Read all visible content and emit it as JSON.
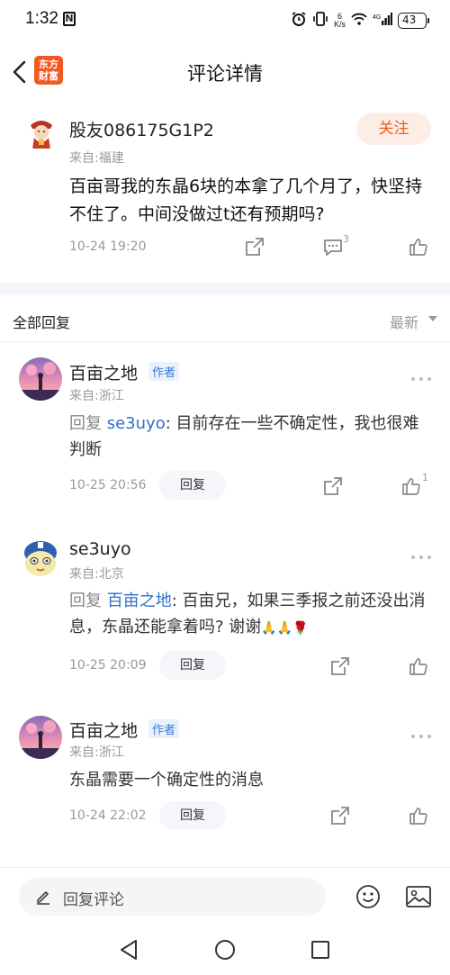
{
  "status_bar": {
    "time": "1:32",
    "n_badge": "N",
    "speed_top": "6",
    "speed_unit": "K/s",
    "battery": "43"
  },
  "header": {
    "title": "评论详情",
    "logo_line1": "东方",
    "logo_line2": "财富"
  },
  "post": {
    "author": "股友086175G1P2",
    "location": "来自:福建",
    "follow_label": "关注",
    "text": "百亩哥我的东晶6块的本拿了几个月了，快坚持不住了。中间没做过t还有预期吗?",
    "time": "10-24 19:20",
    "comment_count": "3"
  },
  "replies_section": {
    "title": "全部回复",
    "sort_label": "最新"
  },
  "replies": [
    {
      "name": "百亩之地",
      "tag": "作者",
      "location": "来自:浙江",
      "reply_word": "回复",
      "mention": "se3uyo",
      "text": ": 目前存在一些不确定性，我也很难判断",
      "time": "10-25 20:56",
      "reply_label": "回复",
      "like_count": "1"
    },
    {
      "name": "se3uyo",
      "location": "来自:北京",
      "reply_word": "回复",
      "mention": "百亩之地",
      "text": ": 百亩兄，如果三季报之前还没出消息，东晶还能拿着吗? 谢谢",
      "emojis": "🙏🙏🌹",
      "time": "10-25 20:09",
      "reply_label": "回复"
    },
    {
      "name": "百亩之地",
      "tag": "作者",
      "location": "来自:浙江",
      "text": "东晶需要一个确定性的消息",
      "time": "10-24 22:02",
      "reply_label": "回复"
    }
  ],
  "bottom_bar": {
    "placeholder": "回复评论"
  },
  "colors": {
    "accent": "#f05a22",
    "link": "#2f6fc9",
    "muted": "#999999"
  }
}
